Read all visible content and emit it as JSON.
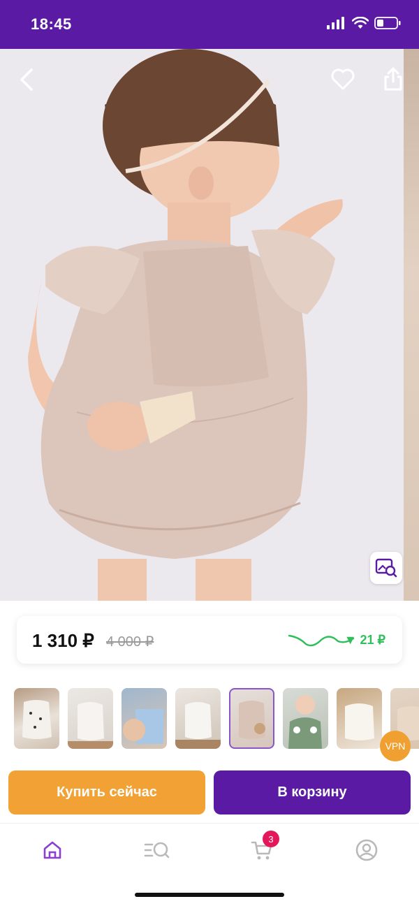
{
  "status_bar": {
    "time": "18:45",
    "icons": [
      "signal-icon",
      "wifi-icon",
      "battery-icon"
    ]
  },
  "hero": {
    "description_icon_back": "chevron-left-icon",
    "icons": [
      "heart-icon",
      "share-icon",
      "image-search-icon"
    ]
  },
  "price": {
    "current": "1 310 ₽",
    "old": "4 000 ₽",
    "trend_delta": "▼ 21 ₽",
    "trend_color": "#2fbf5a"
  },
  "thumbnails": {
    "count": 8,
    "selected_index": 4,
    "vpn_badge": "VPN"
  },
  "actions": {
    "buy_now": "Купить сейчас",
    "add_to_cart": "В корзину"
  },
  "bottom_nav": {
    "items": [
      "home-icon",
      "catalog-search-icon",
      "cart-icon",
      "profile-icon"
    ],
    "cart_count": "3",
    "active": "home"
  },
  "colors": {
    "brand": "#5b1aa3",
    "accent_orange": "#f2a134",
    "badge": "#e3175a"
  }
}
